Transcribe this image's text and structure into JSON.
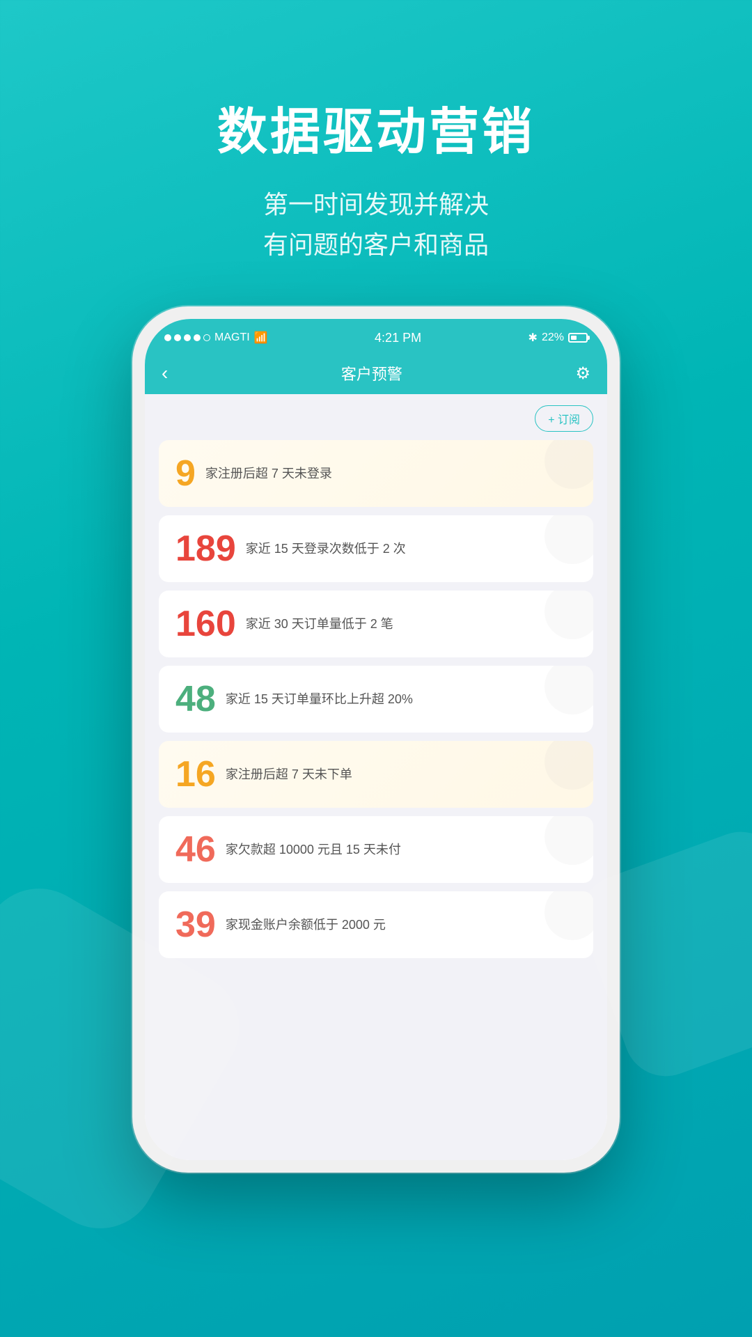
{
  "background": {
    "color": "#00b8b8"
  },
  "header": {
    "title": "数据驱动营销",
    "subtitle_line1": "第一时间发现并解决",
    "subtitle_line2": "有问题的客户和商品"
  },
  "status_bar": {
    "dots": [
      "filled",
      "filled",
      "filled",
      "filled",
      "empty"
    ],
    "carrier": "MAGTI",
    "wifi": "WiFi",
    "time": "4:21 PM",
    "bluetooth": "BT",
    "battery_percent": "22%"
  },
  "nav": {
    "back_icon": "‹",
    "title": "客户预警",
    "settings_icon": "⚙"
  },
  "subscribe_button": "+ 订阅",
  "alerts": [
    {
      "number": "9",
      "number_class": "orange",
      "text": "家注册后超 7 天未登录",
      "bg": "yellow"
    },
    {
      "number": "189",
      "number_class": "red",
      "text": "家近 15 天登录次数低于 2 次",
      "bg": "white"
    },
    {
      "number": "160",
      "number_class": "red",
      "text": "家近 30 天订单量低于 2 笔",
      "bg": "white"
    },
    {
      "number": "48",
      "number_class": "green",
      "text": "家近 15 天订单量环比上升超 20%",
      "bg": "white"
    },
    {
      "number": "16",
      "number_class": "yellow",
      "text": "家注册后超 7 天未下单",
      "bg": "yellow"
    },
    {
      "number": "46",
      "number_class": "coral",
      "text": "家欠款超 10000 元且 15 天未付",
      "bg": "white"
    },
    {
      "number": "39",
      "number_class": "coral",
      "text": "家现金账户余额低于 2000 元",
      "bg": "white"
    }
  ]
}
